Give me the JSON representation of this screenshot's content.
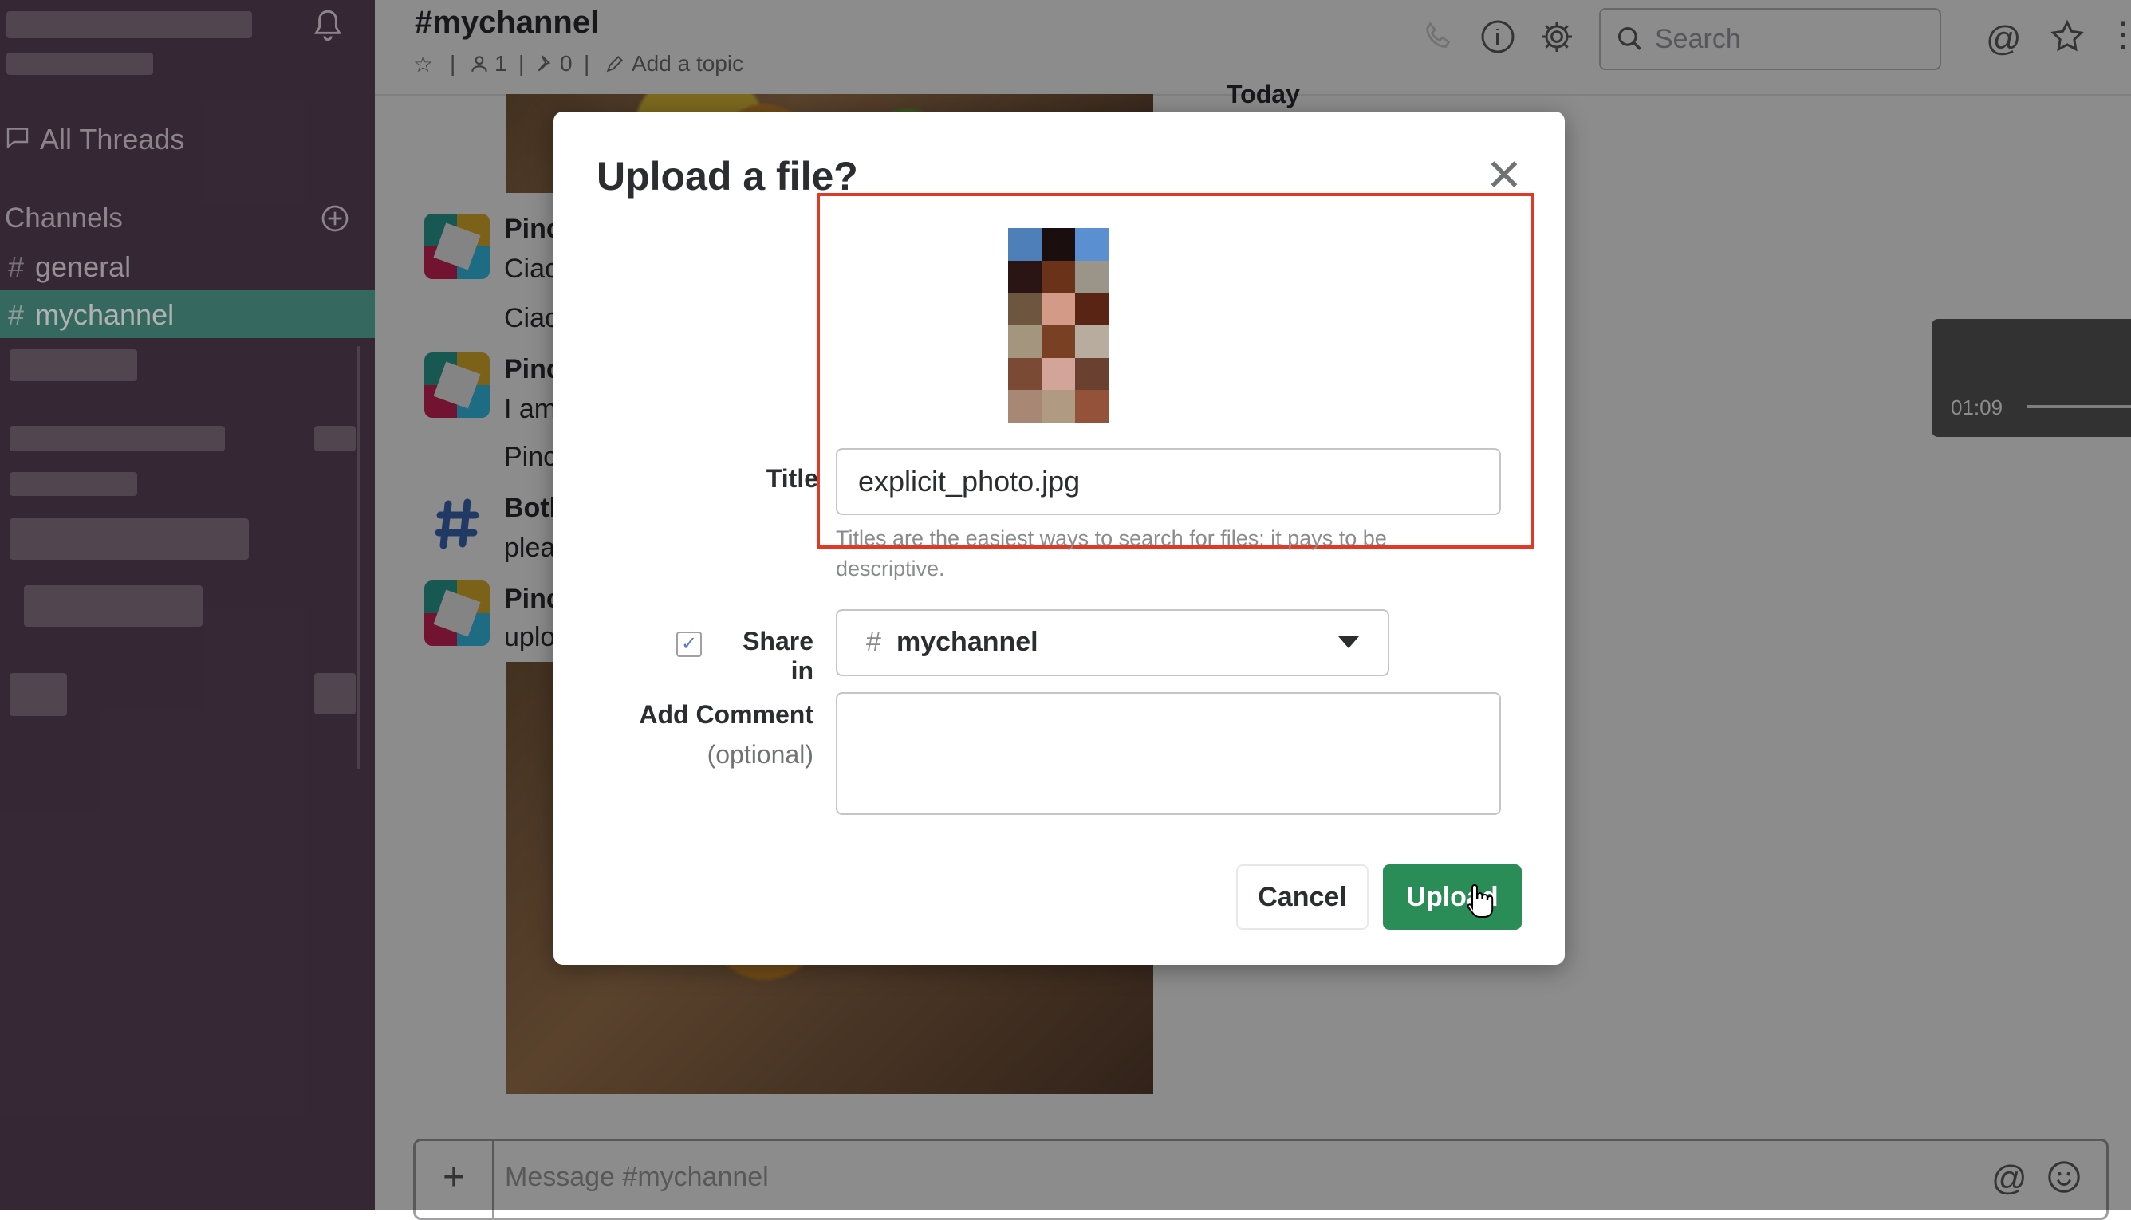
{
  "sidebar": {
    "all_threads": "All Threads",
    "channels_label": "Channels",
    "channels": [
      {
        "hash": "#",
        "name": "general",
        "active": false
      },
      {
        "hash": "#",
        "name": "mychannel",
        "active": true
      }
    ]
  },
  "header": {
    "channel_title": "#mychannel",
    "members_count": "1",
    "pins_count": "0",
    "add_topic": "Add a topic",
    "search_placeholder": "Search",
    "today": "Today"
  },
  "messages": [
    {
      "name": "Pinc",
      "line1": "Ciac",
      "line2": "Ciac"
    },
    {
      "name": "Pinc",
      "line1": "I am",
      "line2": "Pinc"
    },
    {
      "name": "Both",
      "line1": "plea"
    },
    {
      "name": "Pinc",
      "line1": "uplo"
    }
  ],
  "video": {
    "time": "01:09"
  },
  "composer": {
    "plus": "+",
    "placeholder": "Message #mychannel"
  },
  "modal": {
    "title": "Upload a file?",
    "close": "✕",
    "title_label": "Title",
    "title_value": "explicit_photo.jpg",
    "hint": "Titles are the easiest ways to search for files: it pays to be descriptive.",
    "share_label": "Share in",
    "share_checked": true,
    "share_channel_hash": "#",
    "share_channel": "mychannel",
    "comment_label": "Add Comment",
    "comment_optional": "(optional)",
    "cancel": "Cancel",
    "upload": "Upload",
    "accent_color": "#2a8c57",
    "highlight_color": "#e03a26"
  }
}
